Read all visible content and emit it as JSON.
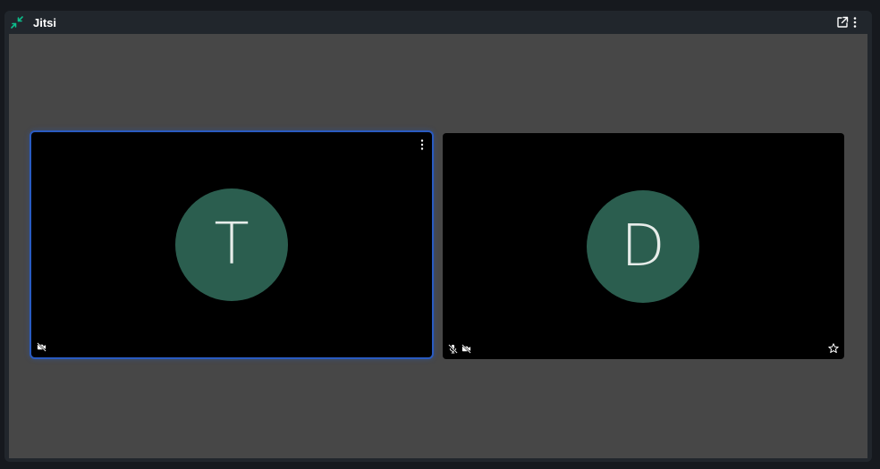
{
  "widget": {
    "title": "Jitsi",
    "icons": {
      "minimize": "minimize-arrows-icon",
      "popout": "external-link-icon",
      "menu": "more-vertical-icon"
    }
  },
  "participants": [
    {
      "initial": "T",
      "self": true,
      "camera_muted": true,
      "mic_muted": false,
      "has_menu": true,
      "avatar_color": "#2b5e4f"
    },
    {
      "initial": "D",
      "self": false,
      "camera_muted": true,
      "mic_muted": true,
      "pinnable": true,
      "avatar_color": "#2b5e4f"
    }
  ],
  "colors": {
    "background": "#16191e",
    "header": "#21262c",
    "stage": "#474747",
    "active_border": "#2a5bc1",
    "accent": "#0dbd8b"
  }
}
